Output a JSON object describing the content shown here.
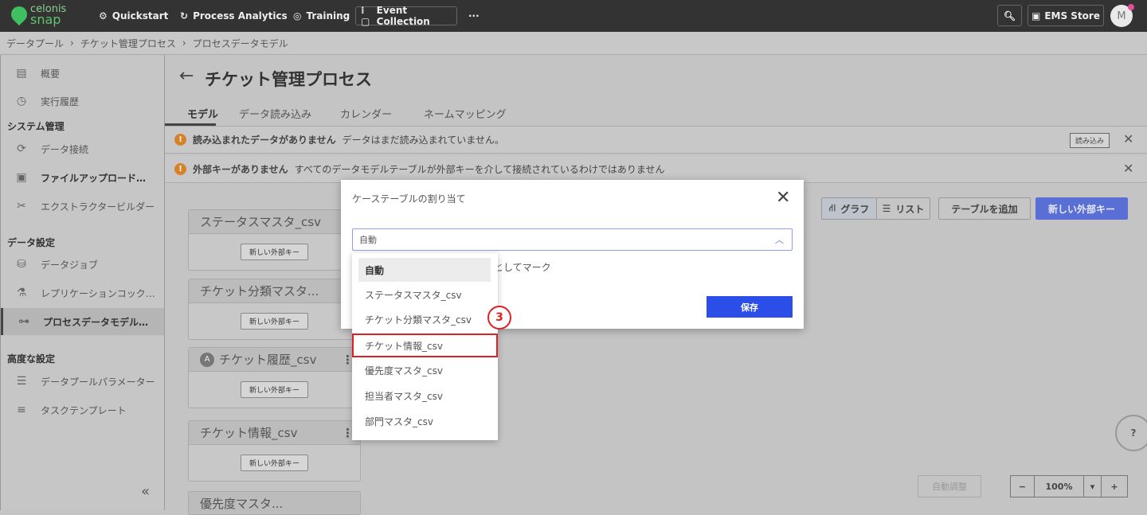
{
  "topbar": {
    "logo": [
      "celonis",
      "snap"
    ],
    "nav": [
      {
        "label": "Quickstart",
        "icon": "gear-icon"
      },
      {
        "label": "Process Analytics",
        "icon": "chart-icon"
      },
      {
        "label": "Training",
        "icon": "graduation-icon"
      },
      {
        "label": "Event Collection",
        "icon": "collection-icon"
      }
    ],
    "more": "···",
    "ems_store": "EMS Store",
    "avatar": "M"
  },
  "breadcrumb": [
    "データプール",
    "チケット管理プロセス",
    "プロセスデータモデル"
  ],
  "sidebar": {
    "items": [
      {
        "label": "概要",
        "icon": "▤"
      },
      {
        "label": "実行履歴",
        "icon": "◷"
      }
    ],
    "section1": "システム管理",
    "items1": [
      {
        "label": "データ接続",
        "icon": "⟳"
      },
      {
        "label": "ファイルアップロード…",
        "icon": "▣"
      },
      {
        "label": "エクストラクタービルダー",
        "icon": "✂"
      }
    ],
    "section2": "データ設定",
    "items2": [
      {
        "label": "データジョブ",
        "icon": "⛁"
      },
      {
        "label": "レプリケーションコック…",
        "icon": "⚗"
      },
      {
        "label": "プロセスデータモデル…",
        "icon": "⊶"
      }
    ],
    "section3": "高度な設定",
    "items3": [
      {
        "label": "データプールパラメーター",
        "icon": "☰"
      },
      {
        "label": "タスクテンプレート",
        "icon": "≡"
      }
    ],
    "collapse": "«"
  },
  "main": {
    "title": "チケット管理プロセス",
    "back": "←",
    "tabs": [
      "モデル",
      "データ読み込み",
      "カレンダー",
      "ネームマッピング"
    ],
    "banners": [
      {
        "title": "読み込まれたデータがありません",
        "text": "データはまだ読み込まれていません。",
        "action": "読み込み"
      },
      {
        "title": "外部キーがありません",
        "text": "すべてのデータモデルテーブルが外部キーを介して接続されているわけではありません"
      }
    ],
    "toolbar": {
      "graph": "グラフ",
      "list": "リスト",
      "add_table": "テーブルを追加",
      "new_fk": "新しい外部キー"
    },
    "cards": [
      {
        "name": "ステータスマスタ_csv"
      },
      {
        "name": "チケット分類マスタ..."
      },
      {
        "name": "チケット履歴_csv",
        "badge": "A"
      },
      {
        "name": "チケット情報_csv"
      },
      {
        "name": "優先度マスタ..."
      }
    ],
    "card_button": "新しい外部キー",
    "zoom": {
      "auto": "自動調整",
      "minus": "−",
      "value": "100%",
      "plus": "+"
    },
    "help": "?"
  },
  "modal": {
    "title": "ケーステーブルの割り当て",
    "select_value": "自動",
    "mark_text": "としてマーク",
    "save": "保存",
    "annotation": "3",
    "options": [
      "自動",
      "ステータスマスタ_csv",
      "チケット分類マスタ_csv",
      "チケット情報_csv",
      "優先度マスタ_csv",
      "担当者マスタ_csv",
      "部門マスタ_csv"
    ]
  }
}
